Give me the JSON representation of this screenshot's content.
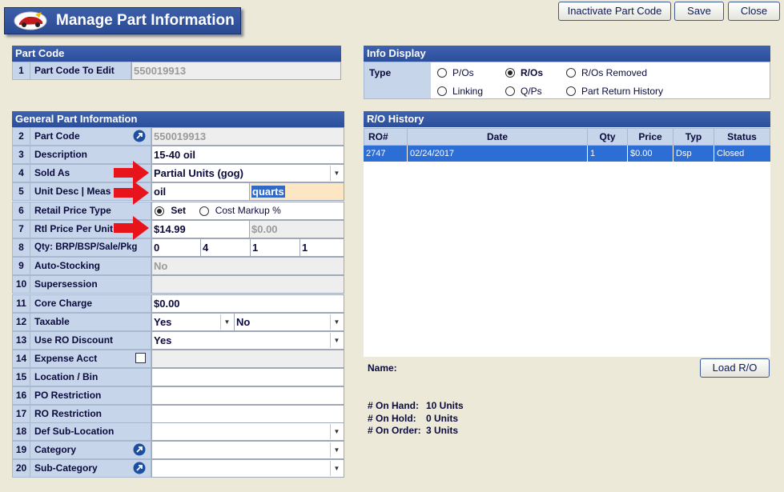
{
  "title": "Manage Part Information",
  "buttons": {
    "inactivate": "Inactivate Part Code",
    "save": "Save",
    "close": "Close",
    "load_ro": "Load R/O"
  },
  "part_code_section": {
    "header": "Part Code",
    "row": {
      "num": "1",
      "label": "Part Code To Edit",
      "value": "550019913"
    }
  },
  "general": {
    "header": "General Part Information",
    "rows": [
      {
        "num": "2",
        "label": "Part Code",
        "value": "550019913"
      },
      {
        "num": "3",
        "label": "Description",
        "value": "15-40 oil"
      },
      {
        "num": "4",
        "label": "Sold As",
        "value": "Partial Units (gog)"
      },
      {
        "num": "5",
        "label": "Unit Desc | Meas",
        "value": "oil",
        "value2": "quarts"
      },
      {
        "num": "6",
        "label": "Retail Price Type",
        "opt1": "Set",
        "opt2": "Cost Markup %"
      },
      {
        "num": "7",
        "label": "Rtl Price Per Unit",
        "value": "$14.99",
        "value2": "$0.00"
      },
      {
        "num": "8",
        "label": "Qty: BRP/BSP/Sale/Pkg",
        "q1": "0",
        "q2": "4",
        "q3": "1",
        "q4": "1"
      },
      {
        "num": "9",
        "label": "Auto-Stocking",
        "value": "No"
      },
      {
        "num": "10",
        "label": "Supersession",
        "value": ""
      },
      {
        "num": "11",
        "label": "Core Charge",
        "value": "$0.00"
      },
      {
        "num": "12",
        "label": "Taxable",
        "value": "Yes",
        "value2": "No"
      },
      {
        "num": "13",
        "label": "Use RO Discount",
        "value": "Yes"
      },
      {
        "num": "14",
        "label": "Expense Acct",
        "value": ""
      },
      {
        "num": "15",
        "label": "Location / Bin",
        "value": ""
      },
      {
        "num": "16",
        "label": "PO Restriction",
        "value": ""
      },
      {
        "num": "17",
        "label": "RO Restriction",
        "value": ""
      },
      {
        "num": "18",
        "label": "Def Sub-Location",
        "value": ""
      },
      {
        "num": "19",
        "label": "Category",
        "value": ""
      },
      {
        "num": "20",
        "label": "Sub-Category",
        "value": ""
      }
    ]
  },
  "info_display": {
    "header": "Info Display",
    "type_label": "Type",
    "options": [
      "P/Os",
      "R/Os",
      "R/Os Removed",
      "Linking",
      "Q/Ps",
      "Part Return History"
    ],
    "selected": "R/Os"
  },
  "ro_history": {
    "header": "R/O History",
    "columns": [
      "RO#",
      "Date",
      "Qty",
      "Price",
      "Typ",
      "Status"
    ],
    "rows": [
      [
        "2747",
        "02/24/2017",
        "1",
        "$0.00",
        "Dsp",
        "Closed"
      ]
    ]
  },
  "name_label": "Name:",
  "summary": {
    "on_hand_label": "# On Hand:",
    "on_hand": "10 Units",
    "on_hold_label": "# On Hold:",
    "on_hold": "0 Units",
    "on_order_label": "# On Order:",
    "on_order": "3 Units"
  },
  "colors": {
    "header_blue": "#2c4f9c",
    "label_bg": "#c7d5ea",
    "selected_row": "#2d6ed6",
    "arrow_red": "#e8141c",
    "highlight_field": "#fde6c4"
  }
}
